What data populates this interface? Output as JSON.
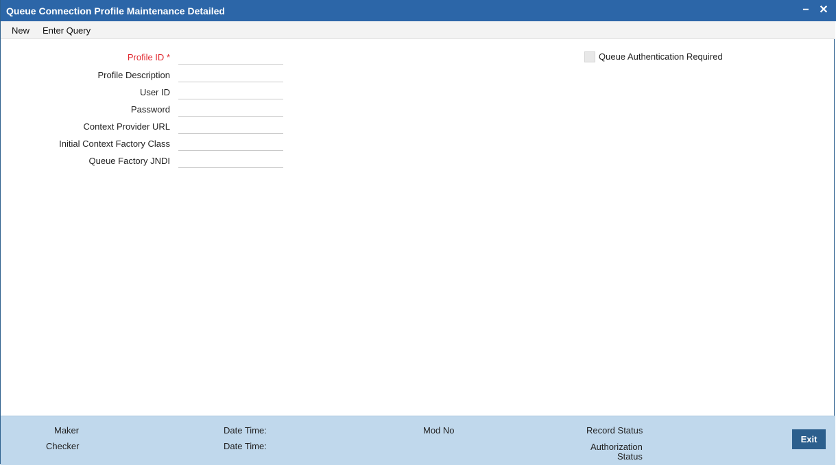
{
  "window": {
    "title": "Queue Connection Profile Maintenance Detailed",
    "minimize_glyph": "−",
    "close_glyph": "✕"
  },
  "menu": {
    "new_label": "New",
    "enter_query_label": "Enter Query"
  },
  "form": {
    "profile_id_label": "Profile ID",
    "required_marker": "*",
    "profile_description_label": "Profile Description",
    "user_id_label": "User ID",
    "password_label": "Password",
    "context_provider_url_label": "Context Provider URL",
    "initial_context_factory_class_label": "Initial Context Factory Class",
    "queue_factory_jndi_label": "Queue Factory JNDI",
    "profile_id_value": "",
    "profile_description_value": "",
    "user_id_value": "",
    "password_value": "",
    "context_provider_url_value": "",
    "initial_context_factory_class_value": "",
    "queue_factory_jndi_value": "",
    "queue_auth_label": "Queue Authentication Required",
    "queue_auth_checked": false
  },
  "footer": {
    "maker_label": "Maker",
    "checker_label": "Checker",
    "maker_datetime_label": "Date Time:",
    "checker_datetime_label": "Date Time:",
    "mod_no_label": "Mod No",
    "record_status_label": "Record Status",
    "authorization_label": "Authorization",
    "status_label": "Status",
    "exit_label": "Exit"
  },
  "colors": {
    "titlebar": "#2c66a8",
    "footer": "#c0d8ec",
    "required": "#e0262d",
    "exit_button": "#2c5f8d"
  }
}
